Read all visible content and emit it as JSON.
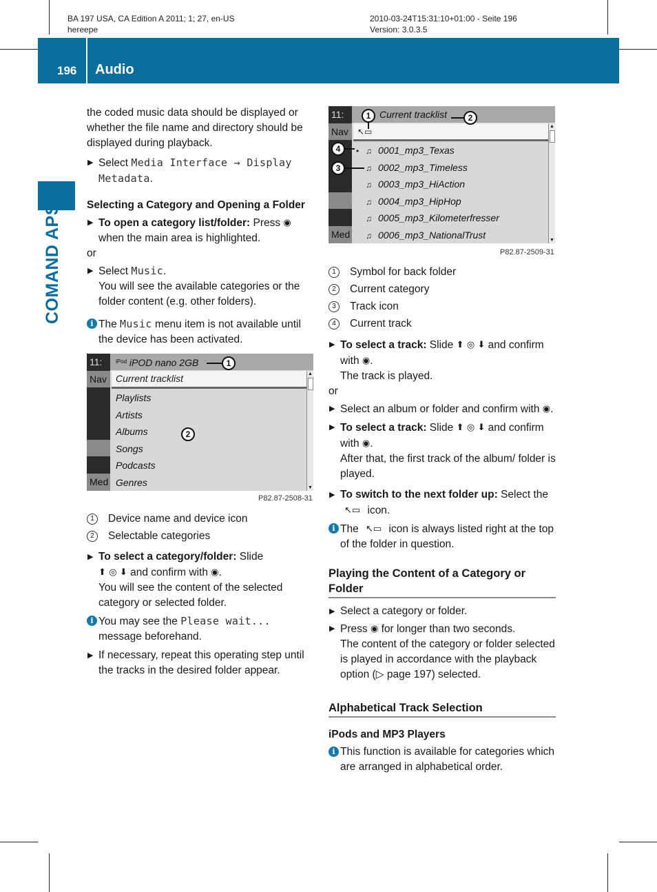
{
  "header": {
    "meta_left_line1": "BA 197 USA, CA Edition A 2011; 1; 27, en-US",
    "meta_left_line2": "hereepe",
    "meta_right_line1": "2010-03-24T15:31:10+01:00 - Seite 196",
    "meta_right_line2": "Version: 3.0.3.5",
    "page_number": "196",
    "section_title": "Audio",
    "brand_color": "#0a6d9c"
  },
  "sidebar": {
    "chapter_label": "COMAND APS"
  },
  "left_column": {
    "intro": "the coded music data should be displayed or whether the file name and directory should be displayed during playback.",
    "step1_prefix": "Select ",
    "step1_mono": "Media Interface → Display Metadata",
    "step1_suffix": ".",
    "heading": "Selecting a Category and Opening a Folder",
    "step2_bold": "To open a category list/folder:",
    "step2_text": " Press ",
    "step2_text2": " when the main area is highlighted.",
    "or1": "or",
    "step3_prefix": "Select ",
    "step3_mono": "Music",
    "step3_suffix": ".",
    "step3_result": "You will see the available categories or the folder content (e.g. other folders).",
    "info1_prefix": "The ",
    "info1_mono": "Music",
    "info1_suffix": " menu item is not available until the device has been activated.",
    "legend": [
      {
        "num": "1",
        "label": "Device name and device icon"
      },
      {
        "num": "2",
        "label": "Selectable categories"
      }
    ],
    "step4_bold": "To select a category/folder:",
    "step4_text": " Slide",
    "step4_text2": " and confirm with ",
    "step4_result": "You will see the content of the selected category or selected folder.",
    "info2_prefix": "You may see the ",
    "info2_mono": "Please wait...",
    "info2_suffix": " message beforehand.",
    "step5": "If necessary, repeat this operating step until the tracks in the desired folder appear."
  },
  "screen1": {
    "clock": "11:",
    "strip_nav": "Nav",
    "strip_media": "Med",
    "device_icon_label": "iPod",
    "title": "iPOD nano 2GB",
    "selected_item": "Current tracklist",
    "items": [
      "Playlists",
      "Artists",
      "Albums",
      "Songs",
      "Podcasts",
      "Genres"
    ],
    "figure_code": "P82.87-2508-31"
  },
  "screen2": {
    "clock": "11:",
    "strip_nav": "Nav",
    "strip_media": "Med",
    "title": "Current tracklist",
    "tracks": [
      "0001_mp3_Texas",
      "0002_mp3_Timeless",
      "0003_mp3_HiAction",
      "0004_mp3_HipHop",
      "0005_mp3_Kilometerfresser",
      "0006_mp3_NationalTrust"
    ],
    "current_track_index": 0,
    "figure_code": "P82.87-2509-31"
  },
  "right_column": {
    "legend": [
      {
        "num": "1",
        "label": "Symbol for back folder"
      },
      {
        "num": "2",
        "label": "Current category"
      },
      {
        "num": "3",
        "label": "Track icon"
      },
      {
        "num": "4",
        "label": "Current track"
      }
    ],
    "step1_bold": "To select a track:",
    "step1_text": " Slide ",
    "step1_text2": " and confirm with ",
    "step1_result": "The track is played.",
    "or1": "or",
    "step2_text": "Select an album or folder and confirm with ",
    "step3_bold": "To select a track:",
    "step3_text": " Slide ",
    "step3_text2": " and confirm with ",
    "step3_result": "After that, the first track of the album/ folder is played.",
    "step4_bold": "To switch to the next folder up:",
    "step4_text": " Select the ",
    "step4_text2": " icon.",
    "info1_prefix": "The ",
    "info1_suffix": " icon is always listed right at the top of the folder in question.",
    "heading1": "Playing the Content of a Category or Folder",
    "step5": "Select a category or folder.",
    "step6_prefix": "Press ",
    "step6_suffix": " for longer than two seconds.",
    "step6_result": "The content of the category or folder selected is played in accordance with the playback option (▷ page 197) selected.",
    "heading2": "Alphabetical Track Selection",
    "subheading": "iPods and MP3 Players",
    "info2": "This function is available for categories which are arranged in alphabetical order."
  },
  "icons": {
    "step_marker": "▶",
    "info": "i",
    "controller_press": "◉",
    "slide_up": "⬆",
    "controller_ring": "◎",
    "slide_down": "⬇",
    "back_folder": "↖▭",
    "note": "♫",
    "current_dot": "•",
    "scroll_up": "▲",
    "scroll_down": "▼"
  }
}
